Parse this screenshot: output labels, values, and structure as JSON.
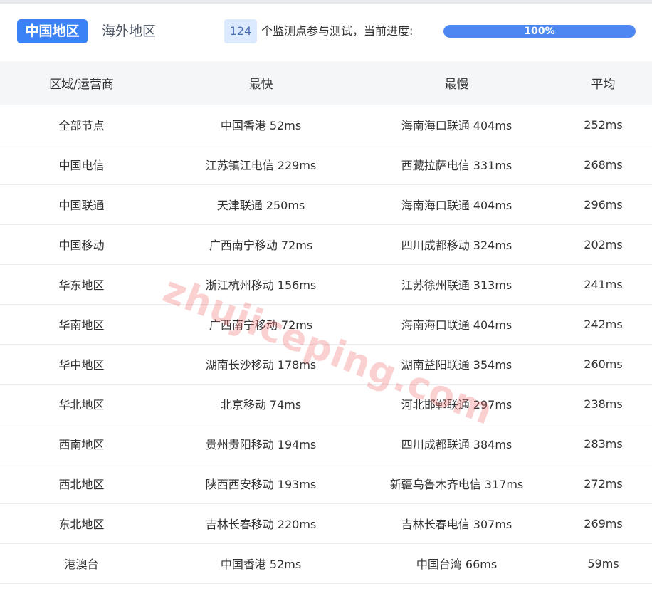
{
  "tabs": [
    {
      "label": "中国地区",
      "active": true
    },
    {
      "label": "海外地区",
      "active": false
    }
  ],
  "monitor": {
    "count": "124",
    "text": "个监测点参与测试，当前进度:",
    "progress_label": "100%",
    "progress_value": 1.0
  },
  "table": {
    "columns": [
      "区域/运营商",
      "最快",
      "最慢",
      "平均"
    ],
    "rows": [
      [
        "全部节点",
        "中国香港 52ms",
        "海南海口联通 404ms",
        "252ms"
      ],
      [
        "中国电信",
        "江苏镇江电信 229ms",
        "西藏拉萨电信 331ms",
        "268ms"
      ],
      [
        "中国联通",
        "天津联通 250ms",
        "海南海口联通 404ms",
        "296ms"
      ],
      [
        "中国移动",
        "广西南宁移动 72ms",
        "四川成都移动 324ms",
        "202ms"
      ],
      [
        "华东地区",
        "浙江杭州移动 156ms",
        "江苏徐州联通 313ms",
        "241ms"
      ],
      [
        "华南地区",
        "广西南宁移动 72ms",
        "海南海口联通 404ms",
        "242ms"
      ],
      [
        "华中地区",
        "湖南长沙移动 178ms",
        "湖南益阳联通 354ms",
        "260ms"
      ],
      [
        "华北地区",
        "北京移动 74ms",
        "河北邯郸联通 297ms",
        "238ms"
      ],
      [
        "西南地区",
        "贵州贵阳移动 194ms",
        "四川成都联通 384ms",
        "283ms"
      ],
      [
        "西北地区",
        "陕西西安移动 193ms",
        "新疆乌鲁木齐电信 317ms",
        "272ms"
      ],
      [
        "东北地区",
        "吉林长春移动 220ms",
        "吉林长春电信 307ms",
        "269ms"
      ],
      [
        "港澳台",
        "中国香港 52ms",
        "中国台湾 66ms",
        "59ms"
      ]
    ]
  },
  "watermark": "zhujiceping.com",
  "colors": {
    "accent": "#3b82f6",
    "progress": "#4d87f2",
    "badge_bg": "#dbeafe",
    "header_bg": "#f5f6f7",
    "watermark": "#f06e6e"
  }
}
